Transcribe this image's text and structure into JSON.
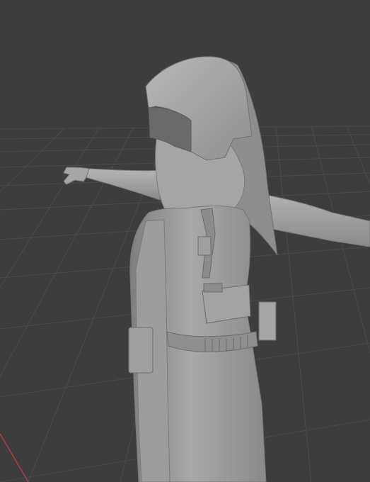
{
  "app": {
    "name": "3D viewport",
    "view": "perspective"
  },
  "scene": {
    "object": "hooded-character-tpose",
    "shading": "solid-gray"
  },
  "colors": {
    "background": "#3d3d3d",
    "grid_line": "#4a4a4a",
    "x_axis": "#b03a46",
    "mesh_base": "#9a9a9a",
    "mesh_light": "#bdbdbd",
    "mesh_dark": "#6f6f6f"
  },
  "icons": [
    "viewport-grid",
    "x-axis-line"
  ]
}
